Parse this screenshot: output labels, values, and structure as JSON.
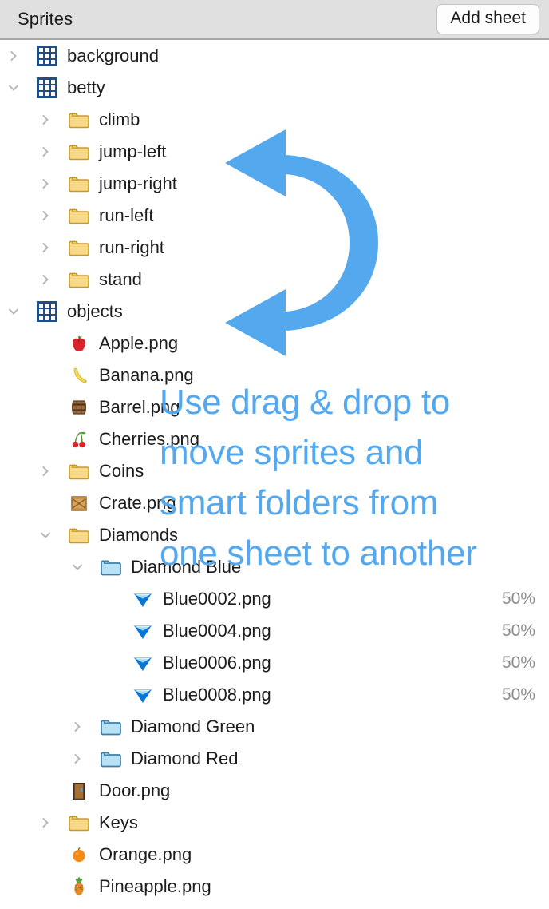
{
  "header": {
    "title": "Sprites",
    "add_sheet_label": "Add sheet"
  },
  "colors": {
    "accent_blue": "#54a8ee",
    "sheet_icon_blue": "#1f4e86",
    "header_bg": "#e0e0e0",
    "folder_yellow": "#f7d98a",
    "smart_folder_blue": "#b9e2f7",
    "percent_gray": "#8c8c8c",
    "text": "#1c1c1c"
  },
  "overlay": {
    "arrow_icon": "curved-double-left-arrow-icon",
    "text_lines": [
      "Use drag & drop to",
      "move sprites and",
      "smart folders from",
      "one sheet to another"
    ]
  },
  "tree": {
    "rows": [
      {
        "label": "background",
        "icon": "sheet-grid-icon",
        "depth": 0,
        "chevron": "collapsed",
        "percent": ""
      },
      {
        "label": "betty",
        "icon": "sheet-grid-icon",
        "depth": 0,
        "chevron": "expanded",
        "percent": ""
      },
      {
        "label": "climb",
        "icon": "folder-icon",
        "depth": 1,
        "chevron": "collapsed",
        "percent": ""
      },
      {
        "label": "jump-left",
        "icon": "folder-icon",
        "depth": 1,
        "chevron": "collapsed",
        "percent": ""
      },
      {
        "label": "jump-right",
        "icon": "folder-icon",
        "depth": 1,
        "chevron": "collapsed",
        "percent": ""
      },
      {
        "label": "run-left",
        "icon": "folder-icon",
        "depth": 1,
        "chevron": "collapsed",
        "percent": ""
      },
      {
        "label": "run-right",
        "icon": "folder-icon",
        "depth": 1,
        "chevron": "collapsed",
        "percent": ""
      },
      {
        "label": "stand",
        "icon": "folder-icon",
        "depth": 1,
        "chevron": "collapsed",
        "percent": ""
      },
      {
        "label": "objects",
        "icon": "sheet-grid-icon",
        "depth": 0,
        "chevron": "expanded",
        "percent": ""
      },
      {
        "label": "Apple.png",
        "icon": "apple-icon",
        "depth": 1,
        "chevron": "none",
        "percent": ""
      },
      {
        "label": "Banana.png",
        "icon": "banana-icon",
        "depth": 1,
        "chevron": "none",
        "percent": ""
      },
      {
        "label": "Barrel.png",
        "icon": "barrel-icon",
        "depth": 1,
        "chevron": "none",
        "percent": ""
      },
      {
        "label": "Cherries.png",
        "icon": "cherries-icon",
        "depth": 1,
        "chevron": "none",
        "percent": ""
      },
      {
        "label": "Coins",
        "icon": "folder-icon",
        "depth": 1,
        "chevron": "collapsed",
        "percent": ""
      },
      {
        "label": "Crate.png",
        "icon": "crate-icon",
        "depth": 1,
        "chevron": "none",
        "percent": ""
      },
      {
        "label": "Diamonds",
        "icon": "folder-icon",
        "depth": 1,
        "chevron": "expanded",
        "percent": ""
      },
      {
        "label": "Diamond Blue",
        "icon": "smart-folder-icon",
        "depth": 2,
        "chevron": "expanded",
        "percent": ""
      },
      {
        "label": "Blue0002.png",
        "icon": "diamond-blue-icon",
        "depth": 3,
        "chevron": "none",
        "percent": "50%"
      },
      {
        "label": "Blue0004.png",
        "icon": "diamond-blue-icon",
        "depth": 3,
        "chevron": "none",
        "percent": "50%"
      },
      {
        "label": "Blue0006.png",
        "icon": "diamond-blue-icon",
        "depth": 3,
        "chevron": "none",
        "percent": "50%"
      },
      {
        "label": "Blue0008.png",
        "icon": "diamond-blue-icon",
        "depth": 3,
        "chevron": "none",
        "percent": "50%"
      },
      {
        "label": "Diamond Green",
        "icon": "smart-folder-icon",
        "depth": 2,
        "chevron": "collapsed",
        "percent": ""
      },
      {
        "label": "Diamond Red",
        "icon": "smart-folder-icon",
        "depth": 2,
        "chevron": "collapsed",
        "percent": ""
      },
      {
        "label": "Door.png",
        "icon": "door-icon",
        "depth": 1,
        "chevron": "none",
        "percent": ""
      },
      {
        "label": "Keys",
        "icon": "folder-icon",
        "depth": 1,
        "chevron": "collapsed",
        "percent": ""
      },
      {
        "label": "Orange.png",
        "icon": "orange-icon",
        "depth": 1,
        "chevron": "none",
        "percent": ""
      },
      {
        "label": "Pineapple.png",
        "icon": "pineapple-icon",
        "depth": 1,
        "chevron": "none",
        "percent": ""
      }
    ]
  }
}
